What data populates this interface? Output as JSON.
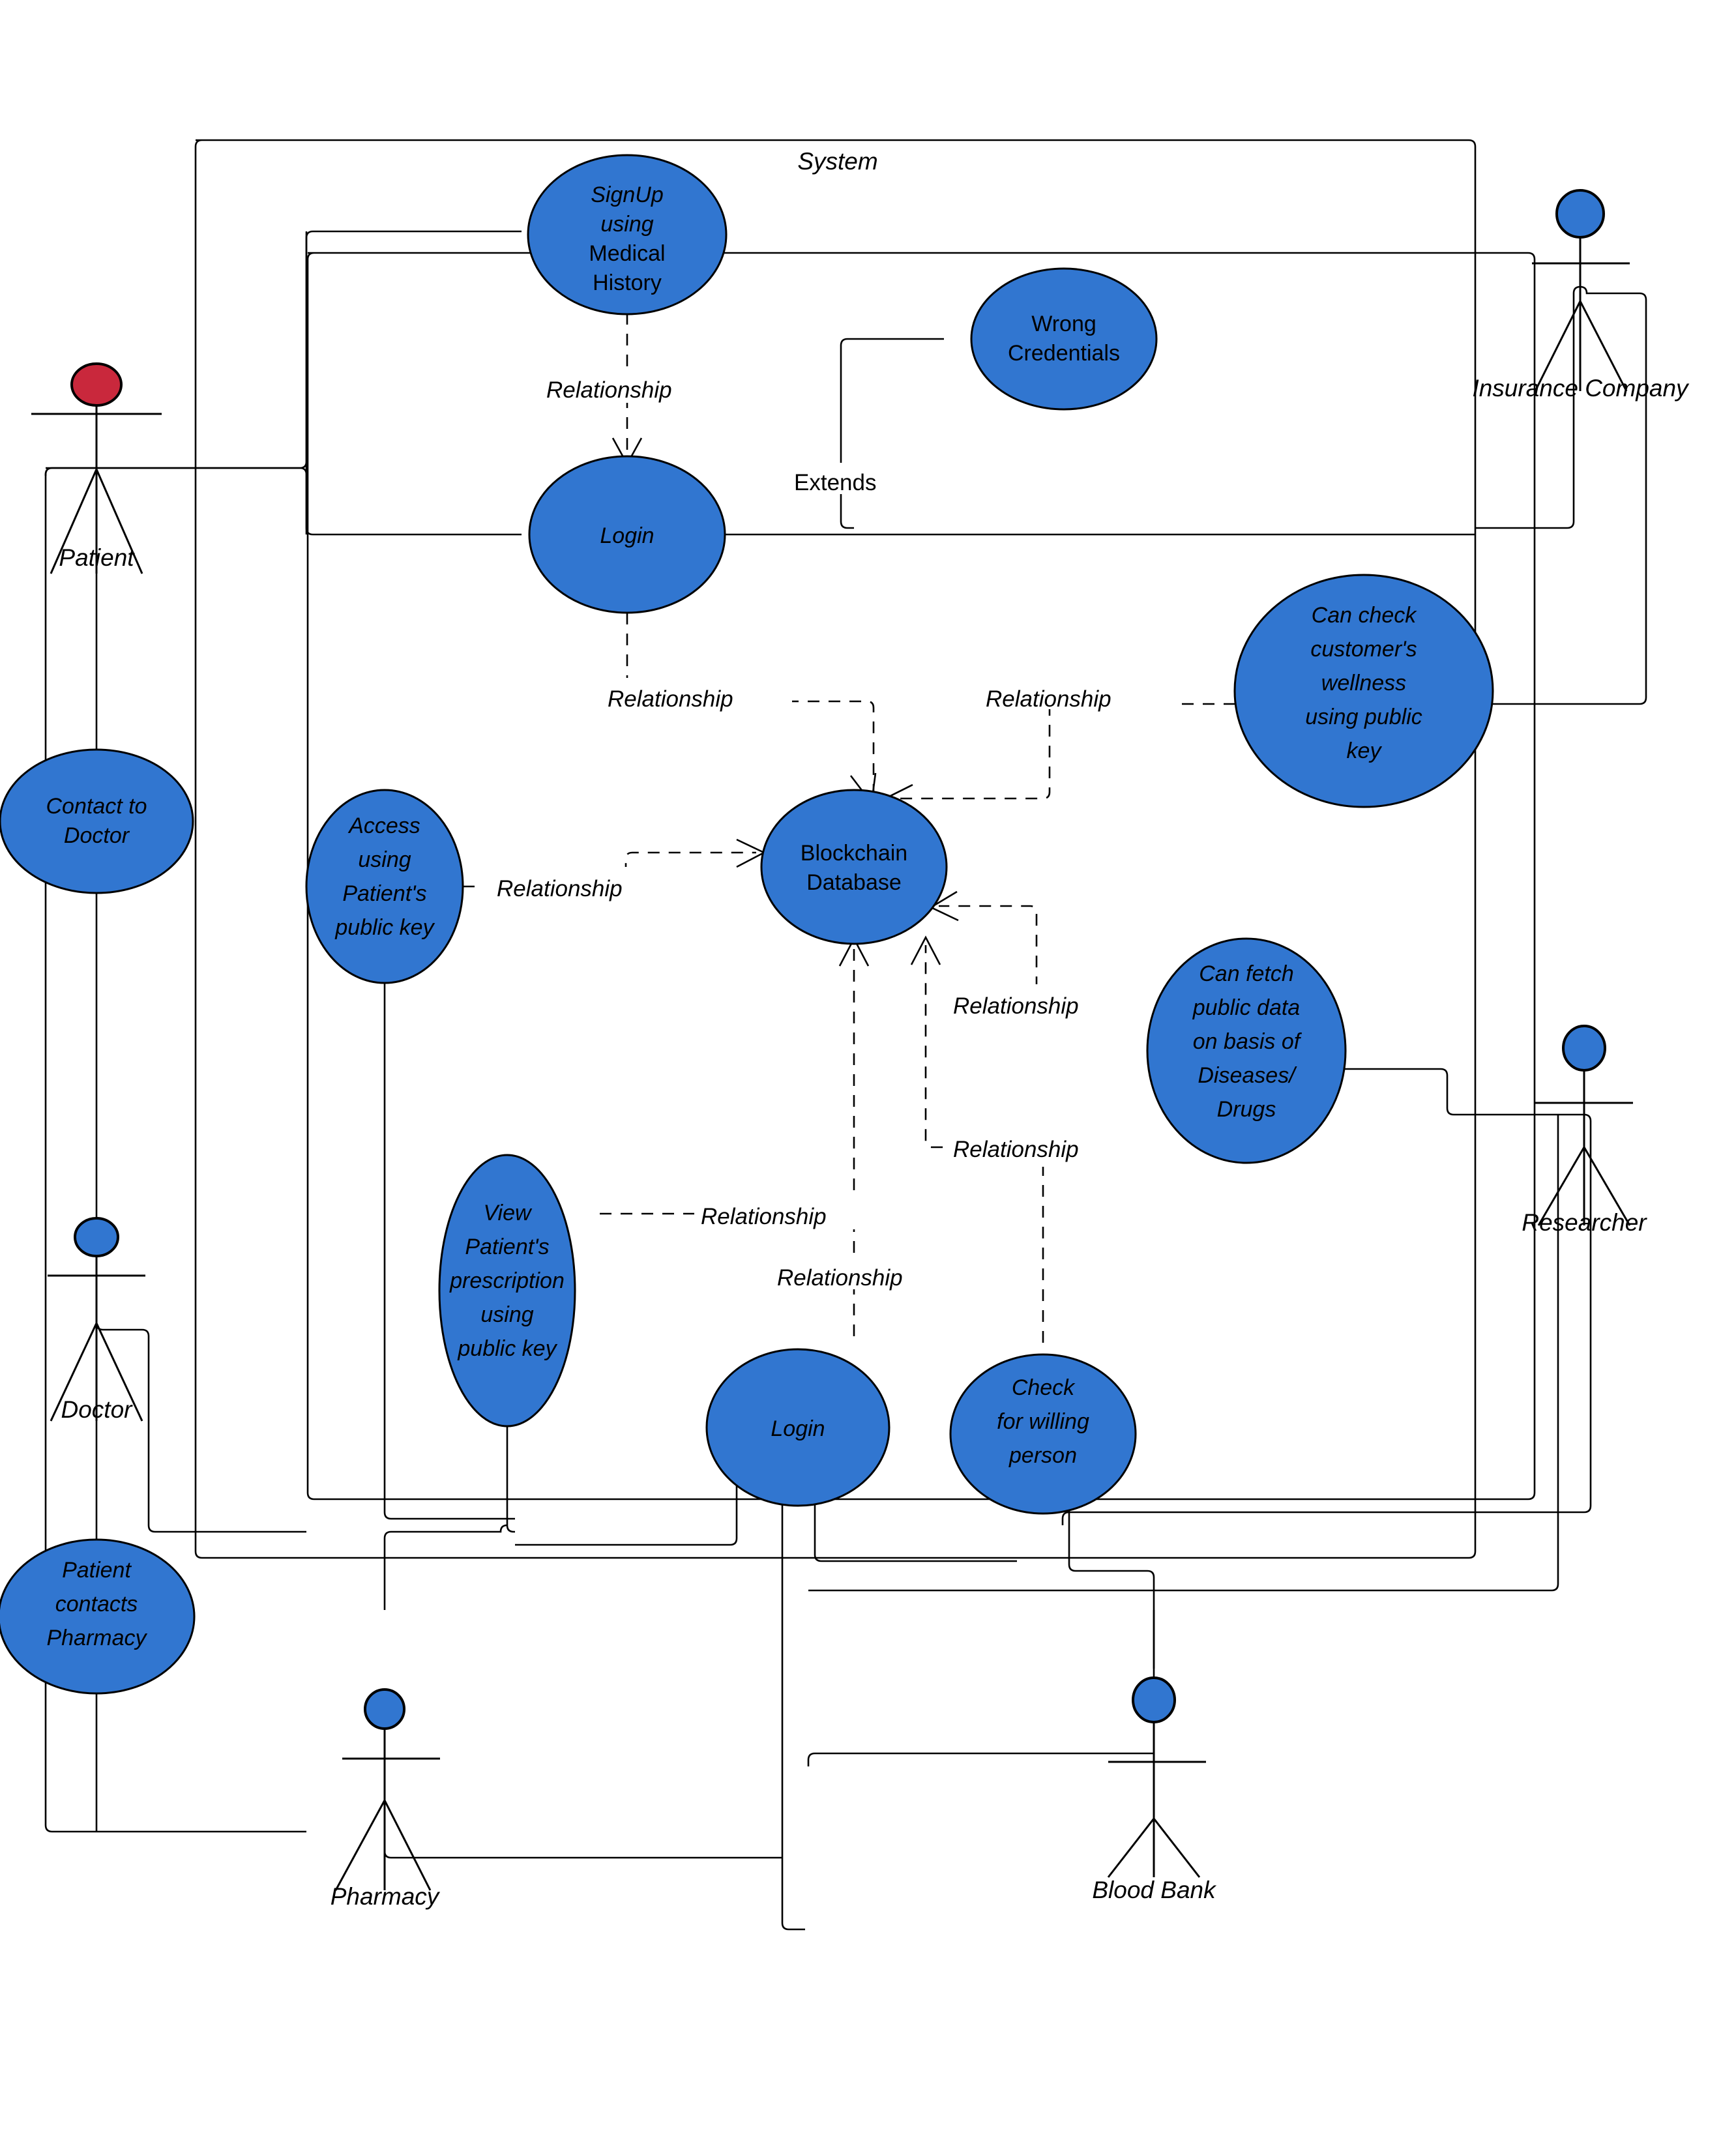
{
  "diagram": {
    "type": "uml-use-case-diagram",
    "system_boundary_label": "System",
    "colors": {
      "use_case_fill": "#3176D0",
      "actor_head_default": "#3176D0",
      "actor_head_patient": "#C9283C",
      "stroke": "#000000",
      "background": "#FFFFFF"
    }
  },
  "actors": [
    {
      "id": "patient",
      "label": "Patient",
      "head_color": "#C9283C"
    },
    {
      "id": "doctor",
      "label": "Doctor",
      "head_color": "#3176D0"
    },
    {
      "id": "pharmacy",
      "label": "Pharmacy",
      "head_color": "#3176D0"
    },
    {
      "id": "blood_bank",
      "label": "Blood Bank",
      "head_color": "#3176D0"
    },
    {
      "id": "insurance_company",
      "label": "Insurance Company",
      "head_color": "#3176D0"
    },
    {
      "id": "researcher",
      "label": "Researcher",
      "head_color": "#3176D0"
    }
  ],
  "use_cases": [
    {
      "id": "signup",
      "lines": [
        "SignUp",
        "using",
        "Medical",
        "History"
      ],
      "italic_lines": [
        true,
        true,
        false,
        false
      ]
    },
    {
      "id": "wrong_credentials",
      "lines": [
        "Wrong",
        "Credentials"
      ],
      "italic_lines": [
        false,
        false
      ]
    },
    {
      "id": "login_top",
      "lines": [
        "Login"
      ],
      "italic_lines": [
        true
      ]
    },
    {
      "id": "contact_to_doctor",
      "lines": [
        "Contact to",
        "Doctor"
      ],
      "italic_lines": [
        true,
        true
      ]
    },
    {
      "id": "access_using_patients_public_key",
      "lines": [
        "Access",
        "using",
        "Patient's",
        "public key"
      ],
      "italic_lines": [
        true,
        true,
        true,
        true
      ]
    },
    {
      "id": "blockchain_database",
      "lines": [
        "Blockchain",
        "Database"
      ],
      "italic_lines": [
        false,
        false
      ]
    },
    {
      "id": "can_check_customers_wellness",
      "lines": [
        "Can check",
        "customer's",
        "wellness",
        "using public",
        "key"
      ],
      "italic_lines": [
        true,
        true,
        true,
        true,
        true
      ]
    },
    {
      "id": "can_fetch_public_data",
      "lines": [
        "Can fetch",
        "public data",
        "on basis of",
        "Diseases/",
        "Drugs"
      ],
      "italic_lines": [
        true,
        true,
        true,
        true,
        true
      ]
    },
    {
      "id": "view_patients_prescription",
      "lines": [
        "View",
        "Patient's",
        "prescription",
        "using",
        "public key"
      ],
      "italic_lines": [
        true,
        true,
        true,
        true,
        true
      ]
    },
    {
      "id": "login_bottom",
      "lines": [
        "Login"
      ],
      "italic_lines": [
        true
      ]
    },
    {
      "id": "check_for_willing_person",
      "lines": [
        "Check",
        "for willing",
        "person"
      ],
      "italic_lines": [
        true,
        true,
        true
      ]
    },
    {
      "id": "patient_contacts_pharmacy",
      "lines": [
        "Patient",
        "contacts",
        "Pharmacy"
      ],
      "italic_lines": [
        true,
        true,
        true
      ]
    }
  ],
  "edge_labels": {
    "relationship": "Relationship",
    "extends": "Extends"
  },
  "relationship_labels": [
    {
      "id": "rel-signup-login",
      "text": "Relationship"
    },
    {
      "id": "rel-login-blockchain",
      "text": "Relationship"
    },
    {
      "id": "rel-wellness-blockchain",
      "text": "Relationship"
    },
    {
      "id": "rel-access-blockchain",
      "text": "Relationship"
    },
    {
      "id": "rel-fetch-blockchain",
      "text": "Relationship"
    },
    {
      "id": "rel-check-blockchain",
      "text": "Relationship"
    },
    {
      "id": "rel-view-prescription",
      "text": "Relationship"
    },
    {
      "id": "rel-login-bottom-blockchain",
      "text": "Relationship"
    }
  ],
  "extends_label": {
    "id": "extends-wrong-credentials",
    "text": "Extends"
  }
}
